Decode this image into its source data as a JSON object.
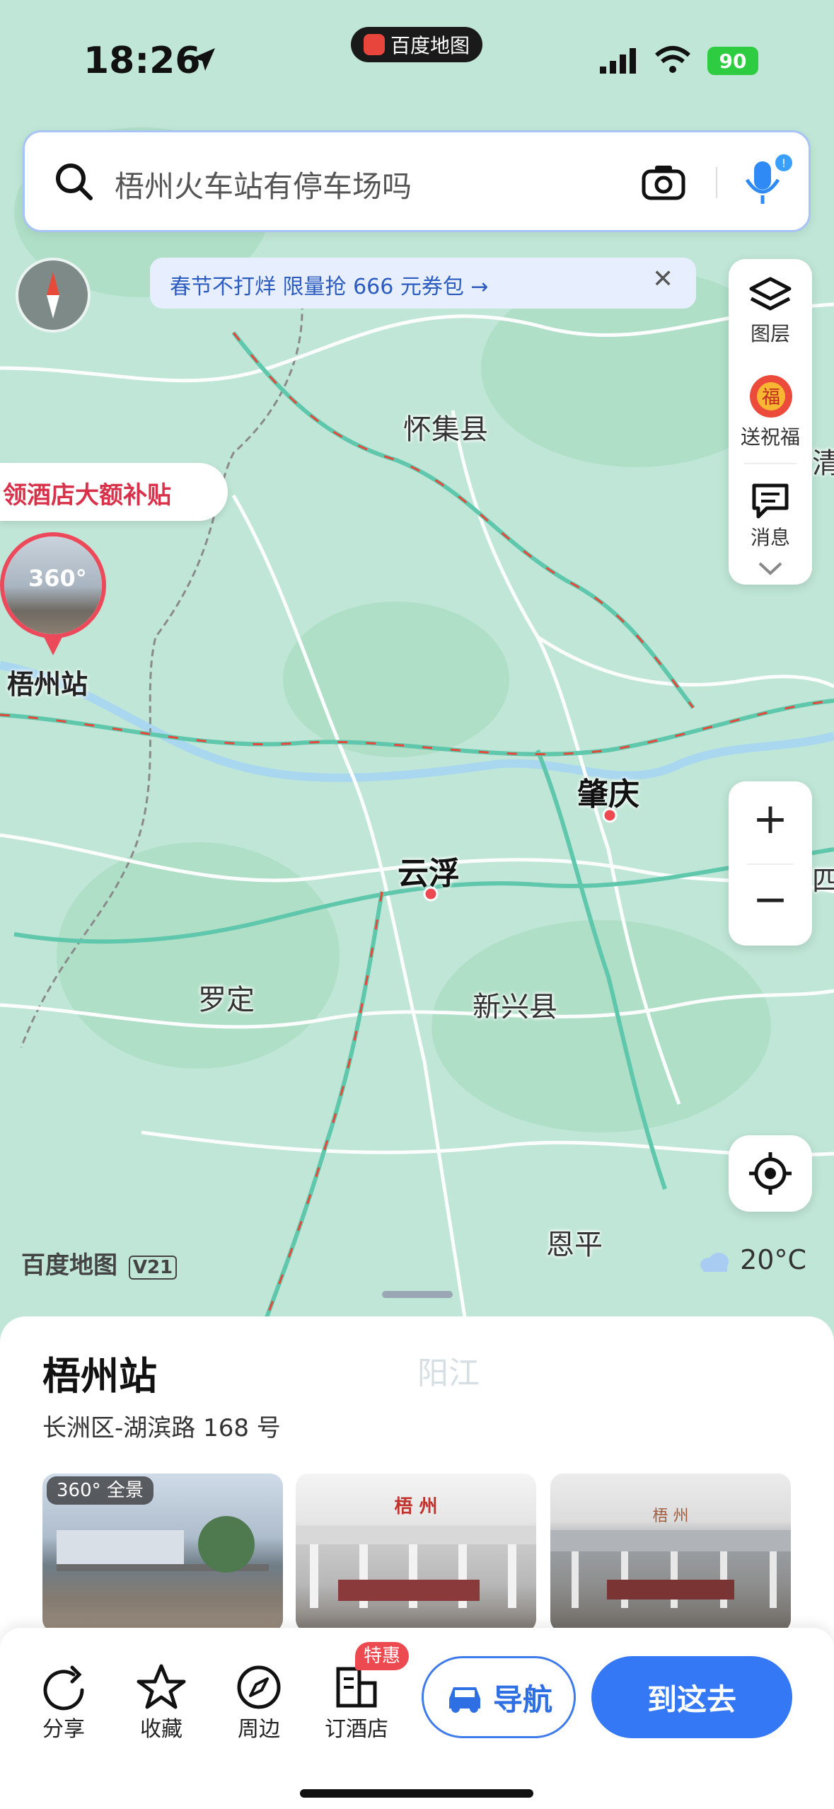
{
  "status_bar": {
    "time": "18:26",
    "app_badge": "百度地图",
    "battery": "90"
  },
  "search": {
    "placeholder": "梧州火车站有停车场吗"
  },
  "promo_banner": {
    "text": "春节不打烊 限量抢 666 元券包 →",
    "close": "✕"
  },
  "right_panel": {
    "layers_label": "图层",
    "blessing_label": "送祝福",
    "messages_label": "消息"
  },
  "zoom": {
    "in": "+",
    "out": "−"
  },
  "map": {
    "hotel_promo": "领酒店大额补贴",
    "pin_360_label": "360°",
    "pin_station": "梧州站",
    "places": {
      "huaiji": "怀集县",
      "zhaoqing": "肇庆",
      "yunfu": "云浮",
      "luoding": "罗定",
      "xinxing": "新兴县",
      "enping": "恩平",
      "yangjiang": "阳江",
      "qing_partial": "清",
      "edge_partial": "四区"
    },
    "watermark": "百度地图",
    "watermark_version": "V21",
    "weather": "20°C"
  },
  "place_sheet": {
    "title": "梧州站",
    "address": "长洲区-湖滨路 168 号",
    "panorama_badge": "360° 全景",
    "photo_sign_2": "梧 州",
    "photo_sign_3": "梧 州"
  },
  "toolbar": {
    "share": "分享",
    "favorite": "收藏",
    "nearby": "周边",
    "hotel": "订酒店",
    "hotel_badge": "特惠",
    "navigate": "导航",
    "go_here": "到这去"
  },
  "colors": {
    "map_bg": "#bfe6d6",
    "road": "#ffffff",
    "highway": "#5fc7ab",
    "river": "#a9d7f0",
    "accent_blue": "#3478f6",
    "accent_red": "#ec4a50"
  }
}
